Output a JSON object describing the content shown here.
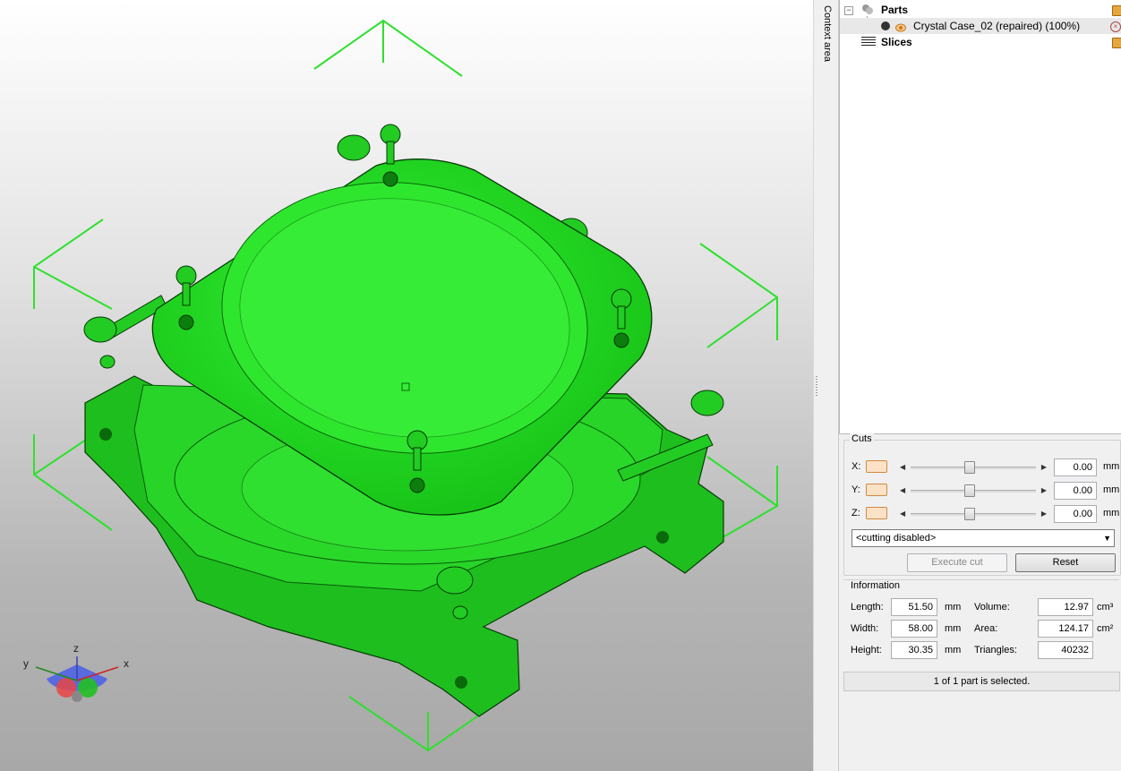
{
  "context_strip": {
    "label": "Context area"
  },
  "tree": {
    "parts_label": "Parts",
    "part_item": "Crystal Case_02 (repaired) (100%)",
    "slices_label": "Slices",
    "expander": "−"
  },
  "axes_widget": {
    "x": "x",
    "y": "y",
    "z": "z"
  },
  "cuts": {
    "title": "Cuts",
    "unit": "mm",
    "rows": [
      {
        "axis": "X:",
        "value": "0.00"
      },
      {
        "axis": "Y:",
        "value": "0.00"
      },
      {
        "axis": "Z:",
        "value": "0.00"
      }
    ],
    "mode_selected": "<cutting disabled>",
    "execute_label": "Execute cut",
    "reset_label": "Reset"
  },
  "information": {
    "title": "Information",
    "length_label": "Length:",
    "length_value": "51.50",
    "length_unit": "mm",
    "width_label": "Width:",
    "width_value": "58.00",
    "width_unit": "mm",
    "height_label": "Height:",
    "height_value": "30.35",
    "height_unit": "mm",
    "volume_label": "Volume:",
    "volume_value": "12.97",
    "volume_unit": "cm³",
    "area_label": "Area:",
    "area_value": "124.17",
    "area_unit": "cm²",
    "triangles_label": "Triangles:",
    "triangles_value": "40232"
  },
  "status": {
    "selection_text": "1 of 1 part is selected."
  },
  "colors": {
    "model": "#22dd22",
    "model_dark": "#0a8a0a",
    "bbox": "#33dd33",
    "accent_orange": "#e8a640"
  }
}
